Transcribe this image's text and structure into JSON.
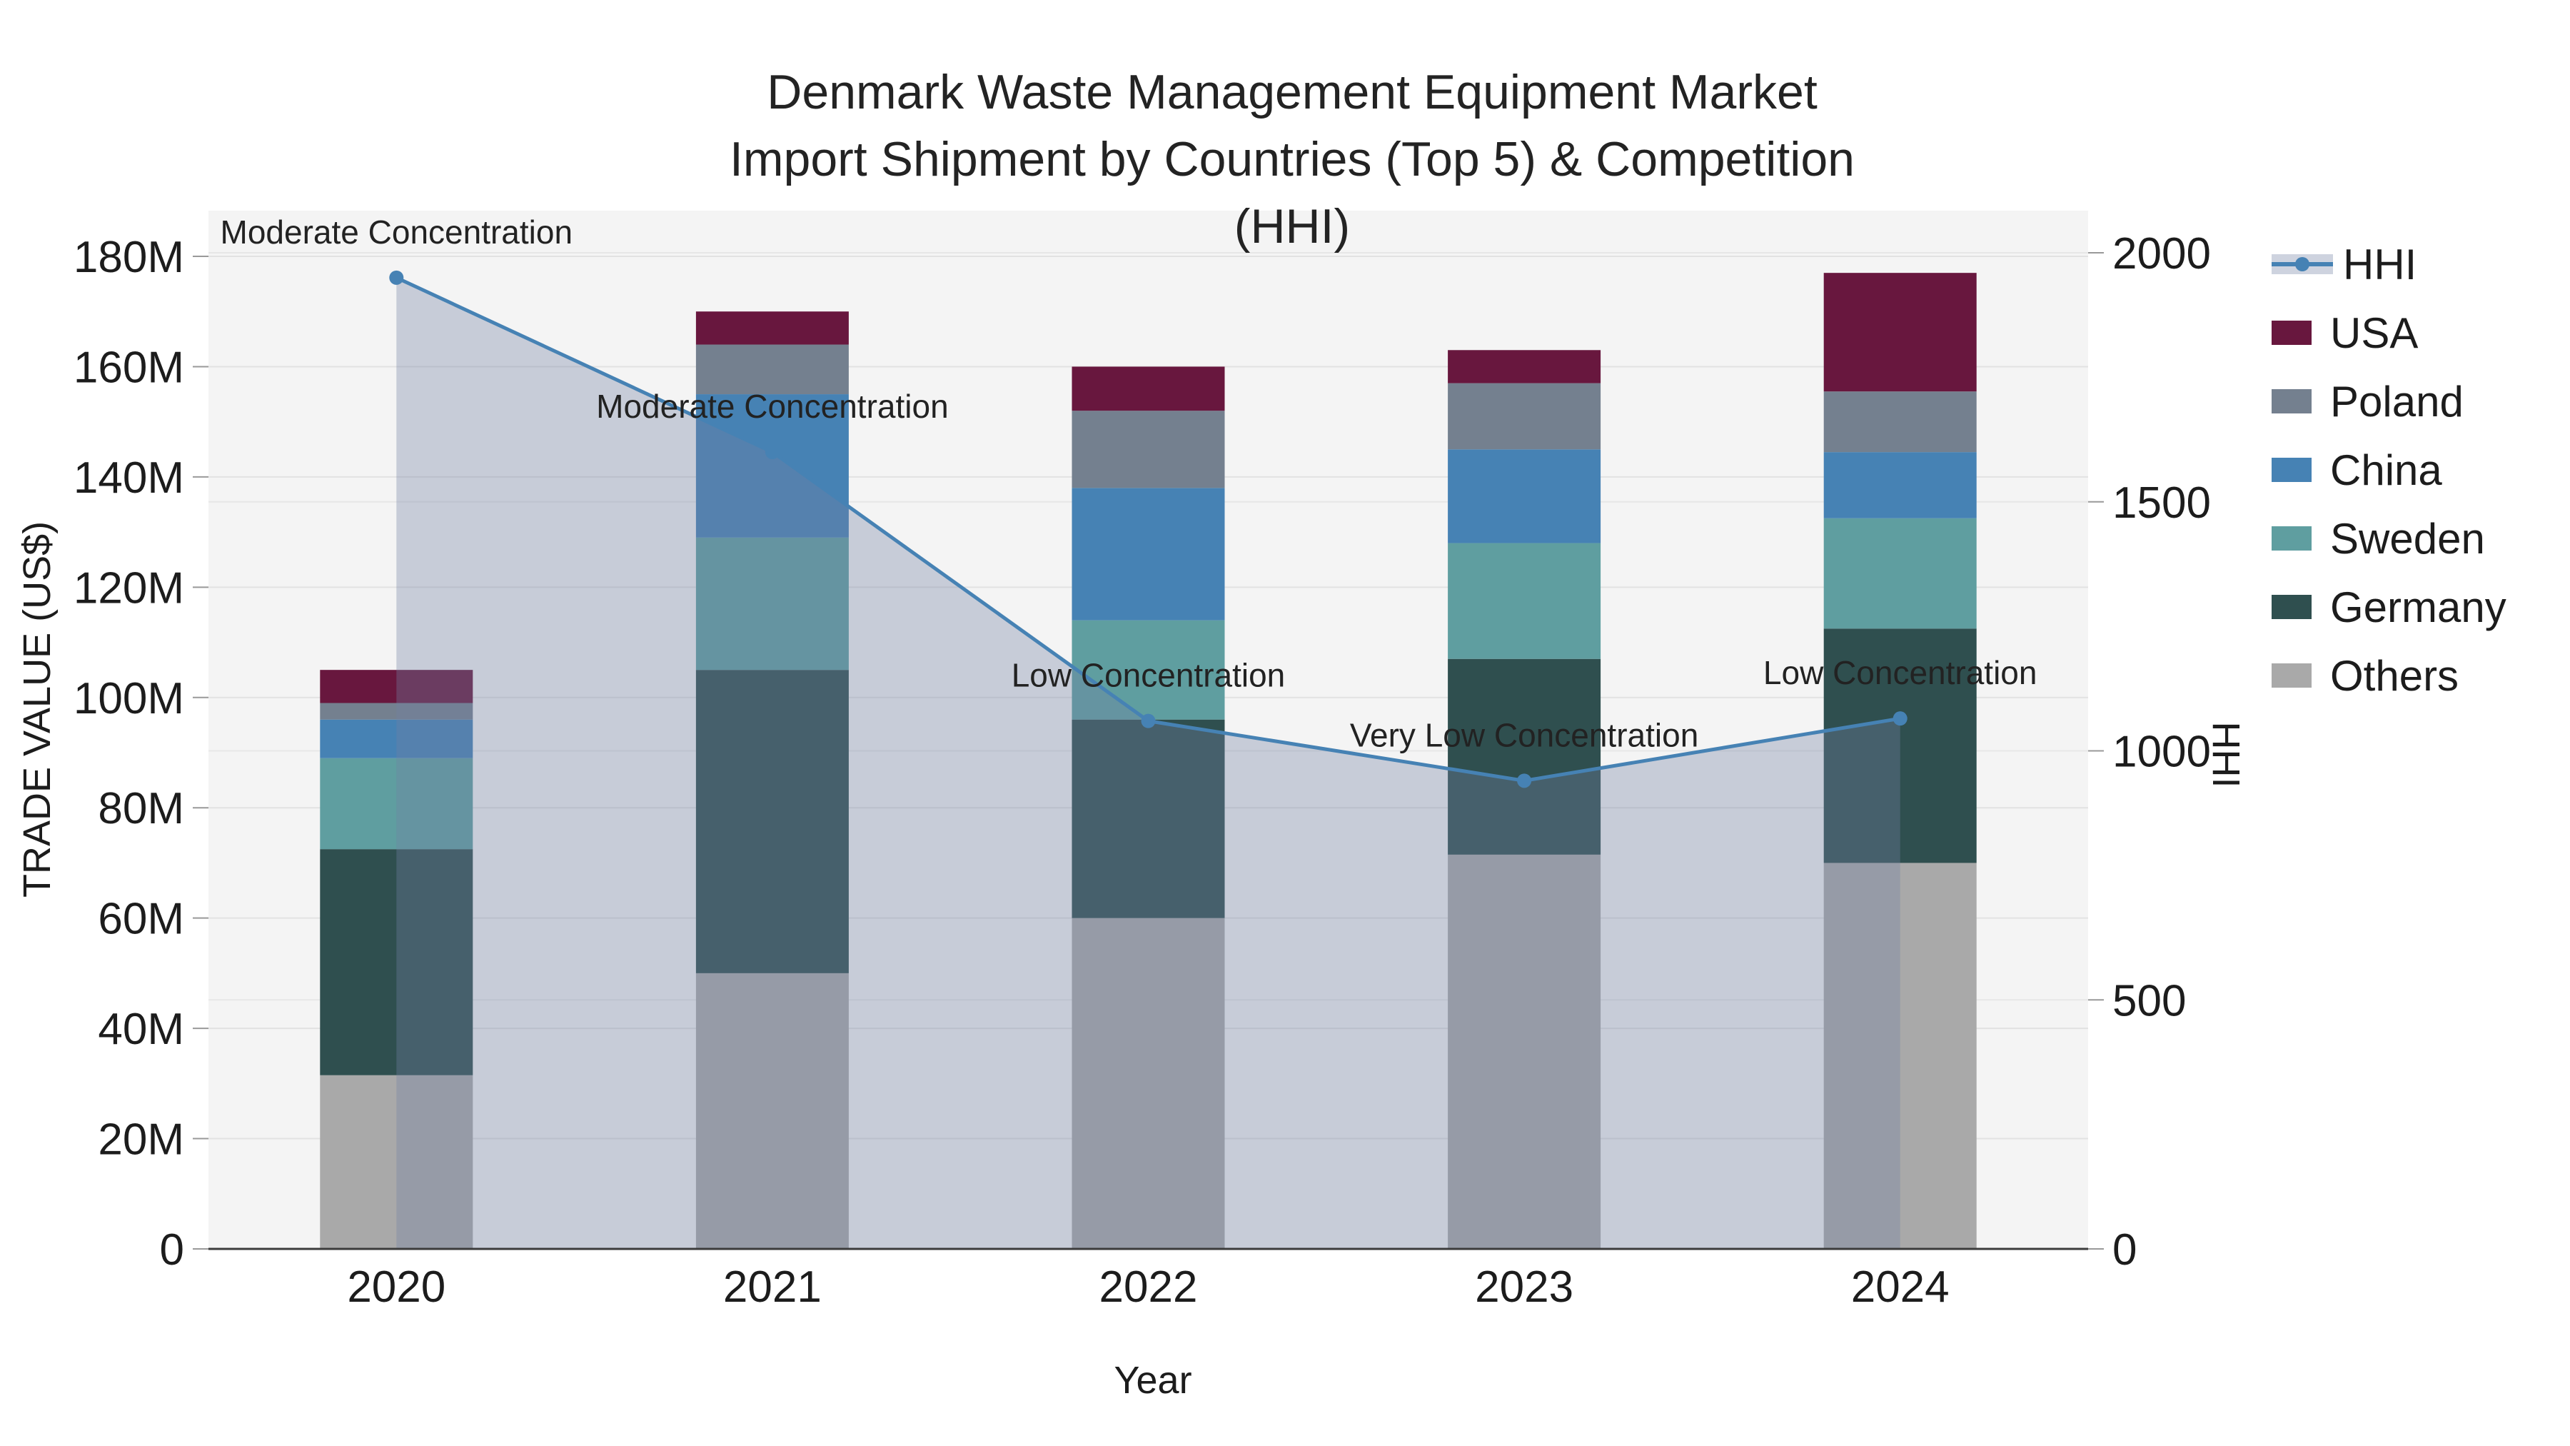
{
  "title": {
    "line1": "Denmark Waste Management Equipment Market",
    "line2": "Import Shipment by Countries (Top 5) & Competition (HHI)"
  },
  "chart_data": {
    "type": "bar",
    "subtype": "stacked-bars-with-line",
    "categories": [
      "2020",
      "2021",
      "2022",
      "2023",
      "2024"
    ],
    "series": [
      {
        "name": "Others",
        "color": "#A9A9A9",
        "values": [
          31.5,
          50,
          60,
          71.5,
          70
        ]
      },
      {
        "name": "Germany",
        "color": "#2F4F4F",
        "values": [
          41,
          55,
          36,
          35.5,
          42.5
        ]
      },
      {
        "name": "Sweden",
        "color": "#5F9EA0",
        "values": [
          16.5,
          24,
          18,
          21,
          20
        ]
      },
      {
        "name": "China",
        "color": "#4682B4",
        "values": [
          7,
          26,
          24,
          17,
          12
        ]
      },
      {
        "name": "Poland",
        "color": "#74808F",
        "values": [
          3,
          9,
          14,
          12,
          11
        ]
      },
      {
        "name": "USA",
        "color": "#68173E",
        "values": [
          6,
          6,
          8,
          6,
          21.5
        ]
      }
    ],
    "totals": [
      105,
      170,
      160,
      163,
      177
    ],
    "hhi": {
      "name": "HHI",
      "values": [
        1950,
        1600,
        1060,
        940,
        1065
      ],
      "line_color": "#4682B4",
      "fill_color": "rgba(115,129,163,0.35)"
    },
    "annotations": [
      {
        "year": "2020",
        "text": "Moderate Concentration"
      },
      {
        "year": "2021",
        "text": "Moderate Concentration"
      },
      {
        "year": "2022",
        "text": "Low Concentration"
      },
      {
        "year": "2023",
        "text": "Very Low Concentration"
      },
      {
        "year": "2024",
        "text": "Low Concentration"
      }
    ],
    "y_left": {
      "title": "TRADE VALUE (US$)",
      "tick_values": [
        0,
        20,
        40,
        60,
        80,
        100,
        120,
        140,
        160,
        180
      ],
      "tick_labels": [
        "0",
        "20M",
        "40M",
        "60M",
        "80M",
        "100M",
        "120M",
        "140M",
        "160M",
        "180M"
      ],
      "range_max_m": 188
    },
    "y_right": {
      "title": "HHI",
      "tick_values": [
        0,
        500,
        1000,
        1500,
        2000
      ],
      "tick_labels": [
        "0",
        "500",
        "1000",
        "1500",
        "2000"
      ],
      "range_max": 2085
    },
    "x_axis": {
      "title": "Year"
    },
    "legend_order": [
      "HHI",
      "USA",
      "Poland",
      "China",
      "Sweden",
      "Germany",
      "Others"
    ],
    "plot_background": "#F4F4F4"
  }
}
